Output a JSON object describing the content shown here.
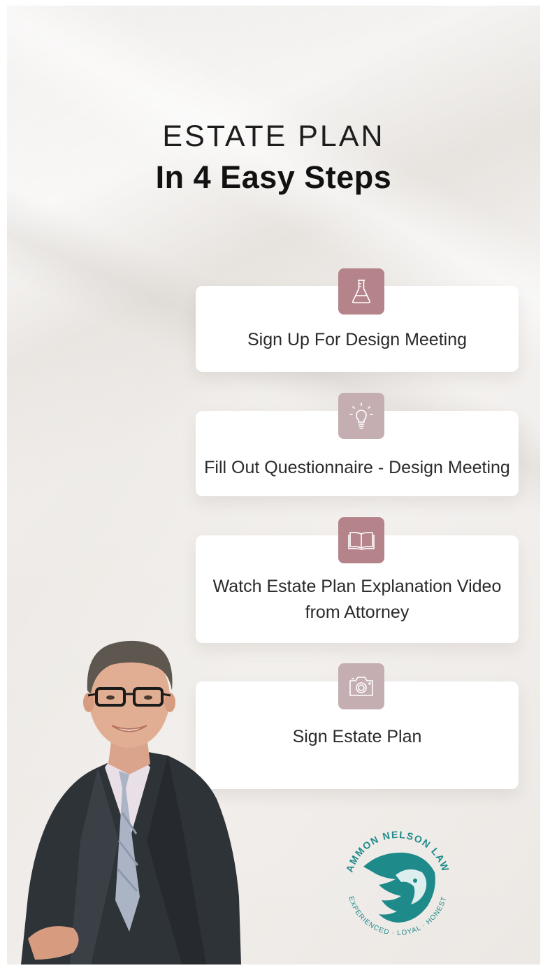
{
  "header": {
    "title_line1": "ESTATE PLAN",
    "title_line2": "In 4 Easy Steps"
  },
  "steps": [
    {
      "label": "Sign Up For Design Meeting",
      "icon": "flask-icon",
      "badge_color": "#b5838a"
    },
    {
      "label": "Fill Out Questionnaire - Design Meeting",
      "icon": "lightbulb-icon",
      "badge_color": "#c4aeb1"
    },
    {
      "label": "Watch Estate Plan Explanation Video from Attorney",
      "icon": "open-book-icon",
      "badge_color": "#b5838a"
    },
    {
      "label": "Sign Estate Plan",
      "icon": "camera-icon",
      "badge_color": "#c4aeb1"
    }
  ],
  "logo": {
    "top_text": "AMMON NELSON LAW",
    "bottom_text": "EXPERIENCED · LOYAL · HONEST",
    "color": "#1e8a8a"
  },
  "colors": {
    "background": "#ece8e4",
    "card": "#ffffff",
    "badge_primary": "#b5838a",
    "badge_light": "#c4aeb1"
  }
}
